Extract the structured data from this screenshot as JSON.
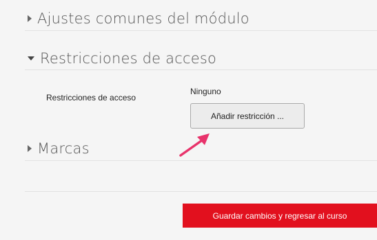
{
  "sections": {
    "common": {
      "title": "Ajustes comunes del módulo",
      "expanded": false
    },
    "restrictions": {
      "title": "Restricciones de acceso",
      "expanded": true
    },
    "tags": {
      "title": "Marcas",
      "expanded": false
    }
  },
  "restriction_field": {
    "label": "Restricciones de acceso",
    "value": "Ninguno",
    "add_button_label": "Añadir restricción ..."
  },
  "save_button_label": "Guardar cambios y regresar al curso",
  "colors": {
    "accent": "#e2101e",
    "arrow": "#e8336b"
  }
}
